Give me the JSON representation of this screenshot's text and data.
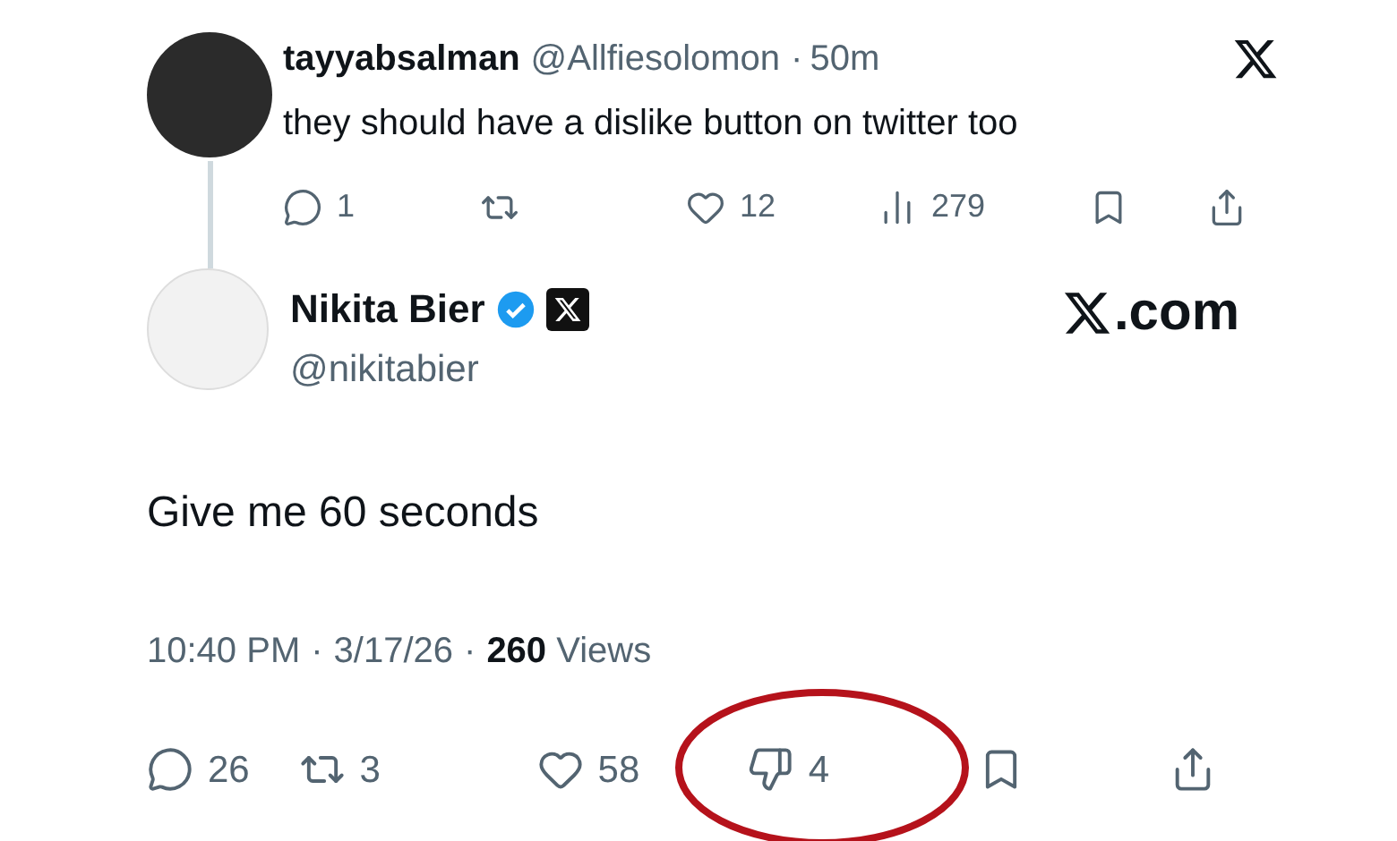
{
  "parent_tweet": {
    "display_name": "tayyabsalman",
    "handle": "@Allfiesolomon",
    "separator": "·",
    "time": "50m",
    "text": "they should have a dislike button on twitter too",
    "actions": [
      {
        "kind": "reply",
        "count": "1"
      },
      {
        "kind": "repost"
      },
      {
        "kind": "like",
        "count": "12"
      },
      {
        "kind": "views",
        "count": "279"
      },
      {
        "kind": "bookmark"
      },
      {
        "kind": "share"
      }
    ]
  },
  "reply_tweet": {
    "display_name": "Nikita Bier",
    "verified": true,
    "handle": "@nikitabier",
    "source_label": ".com",
    "text": "Give me 60 seconds",
    "meta": [
      {
        "kind": "plain",
        "text": "10:40 PM"
      },
      {
        "kind": "sep",
        "text": "·"
      },
      {
        "kind": "plain",
        "text": "3/17/26"
      },
      {
        "kind": "sep",
        "text": "·"
      },
      {
        "kind": "rich",
        "text": "**260** Views"
      }
    ],
    "actions": [
      {
        "kind": "reply",
        "count": "26",
        "highlighted": false
      },
      {
        "kind": "repost",
        "count": "3",
        "highlighted": false
      },
      {
        "kind": "like",
        "count": "58",
        "highlighted": false
      },
      {
        "kind": "dislike",
        "count": "4",
        "highlighted": true
      },
      {
        "kind": "bookmark",
        "highlighted": false
      },
      {
        "kind": "share",
        "highlighted": false
      }
    ]
  }
}
